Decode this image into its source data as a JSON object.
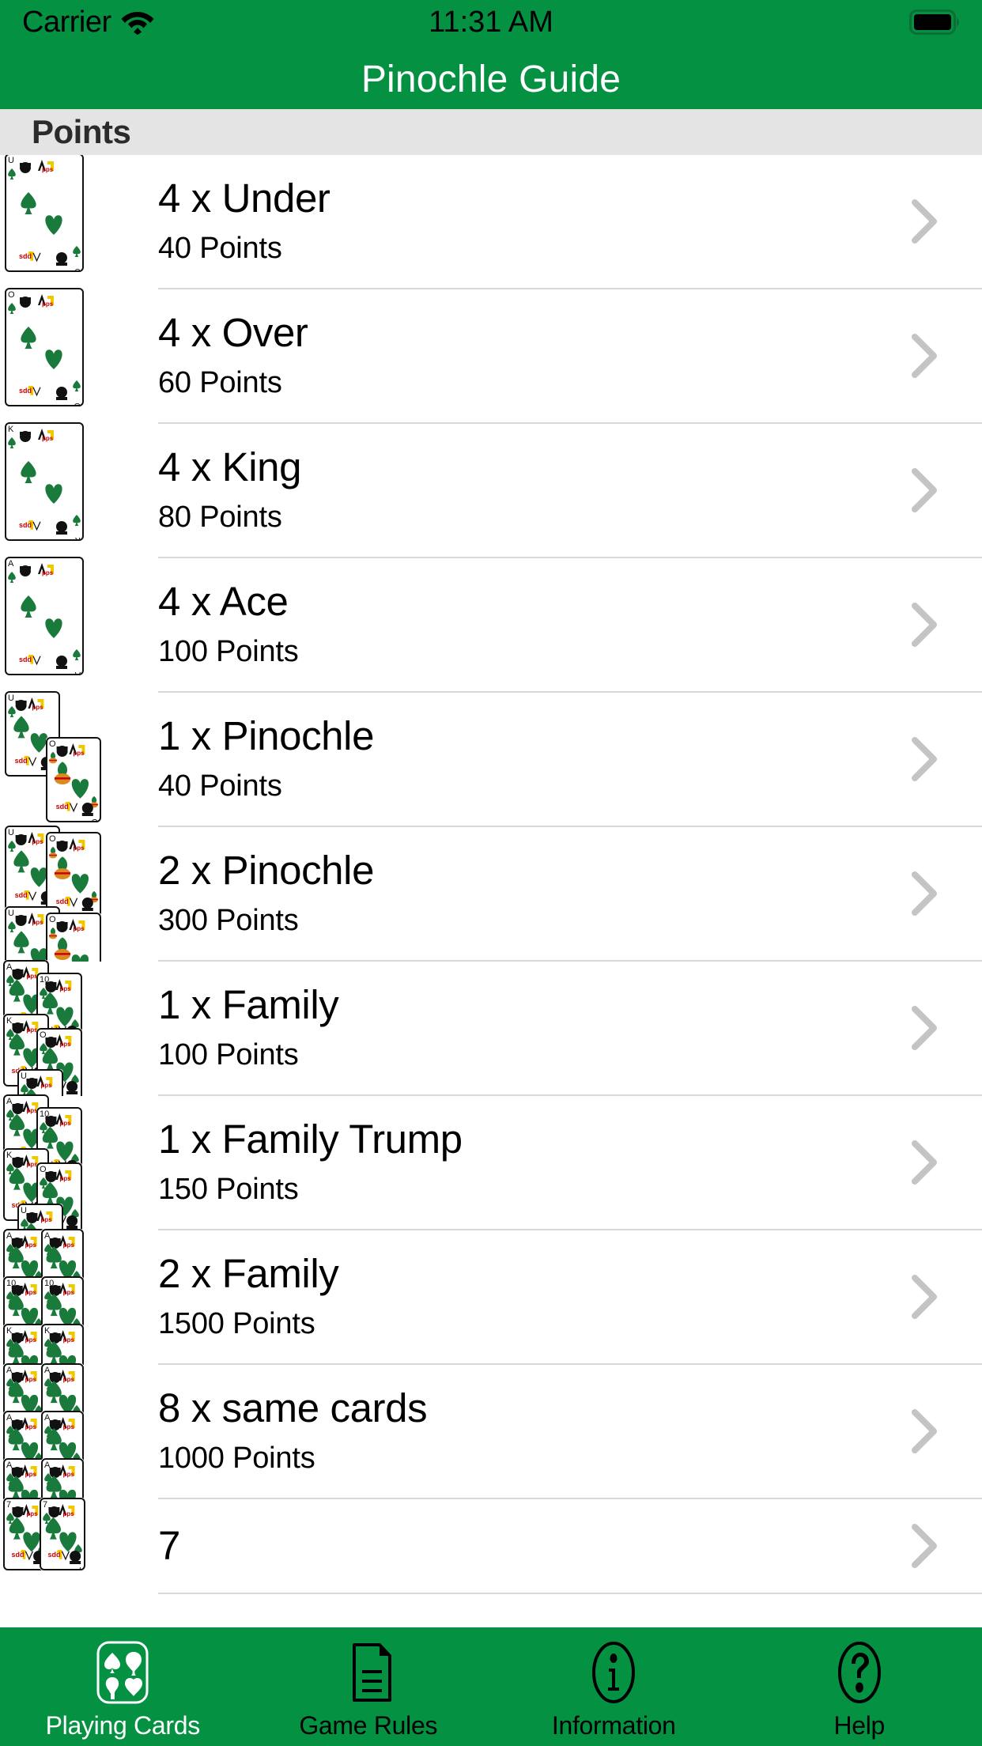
{
  "status_bar": {
    "carrier": "Carrier",
    "wifi_icon": "wifi-icon",
    "time": "11:31 AM",
    "battery_icon": "battery-full-icon"
  },
  "nav": {
    "title": "Pinochle Guide"
  },
  "section": {
    "header": "Points"
  },
  "theme": {
    "accent": "#059142",
    "section_bg": "#e4e4e4",
    "separator": "#d8d8d8",
    "chevron": "#c4c4c4",
    "card_suit_green": "#1a7a3c",
    "card_suit_dark": "#0d5c2c",
    "logo_red": "#cc0000",
    "logo_yellow": "#f0c800"
  },
  "list": {
    "rows": [
      {
        "title": "4 x Under",
        "points": "40 Points",
        "art": "four-unders",
        "chevron": "chevron-right-icon"
      },
      {
        "title": "4 x Over",
        "points": "60 Points",
        "art": "four-overs",
        "chevron": "chevron-right-icon"
      },
      {
        "title": "4 x King",
        "points": "80 Points",
        "art": "four-kings",
        "chevron": "chevron-right-icon"
      },
      {
        "title": "4 x Ace",
        "points": "100 Points",
        "art": "four-aces",
        "chevron": "chevron-right-icon"
      },
      {
        "title": "1 x Pinochle",
        "points": "40 Points",
        "art": "one-pinochle",
        "chevron": "chevron-right-icon"
      },
      {
        "title": "2 x Pinochle",
        "points": "300 Points",
        "art": "two-pinochle",
        "chevron": "chevron-right-icon"
      },
      {
        "title": "1 x Family",
        "points": "100 Points",
        "art": "one-family",
        "chevron": "chevron-right-icon"
      },
      {
        "title": "1 x Family Trump",
        "points": "150 Points",
        "art": "one-family-trump",
        "chevron": "chevron-right-icon"
      },
      {
        "title": "2 x Family",
        "points": "1500 Points",
        "art": "two-family",
        "chevron": "chevron-right-icon"
      },
      {
        "title": "8 x same cards",
        "points": "1000 Points",
        "art": "eight-same-cards",
        "chevron": "chevron-right-icon"
      },
      {
        "title": "7",
        "points": "",
        "art": "seven",
        "chevron": "chevron-right-icon"
      }
    ]
  },
  "tabbar": {
    "tabs": [
      {
        "label": "Playing Cards",
        "icon": "playing-cards-icon",
        "selected": true
      },
      {
        "label": "Game Rules",
        "icon": "document-icon",
        "selected": false
      },
      {
        "label": "Information",
        "icon": "info-circle-icon",
        "selected": false
      },
      {
        "label": "Help",
        "icon": "question-circle-icon",
        "selected": false
      }
    ]
  }
}
